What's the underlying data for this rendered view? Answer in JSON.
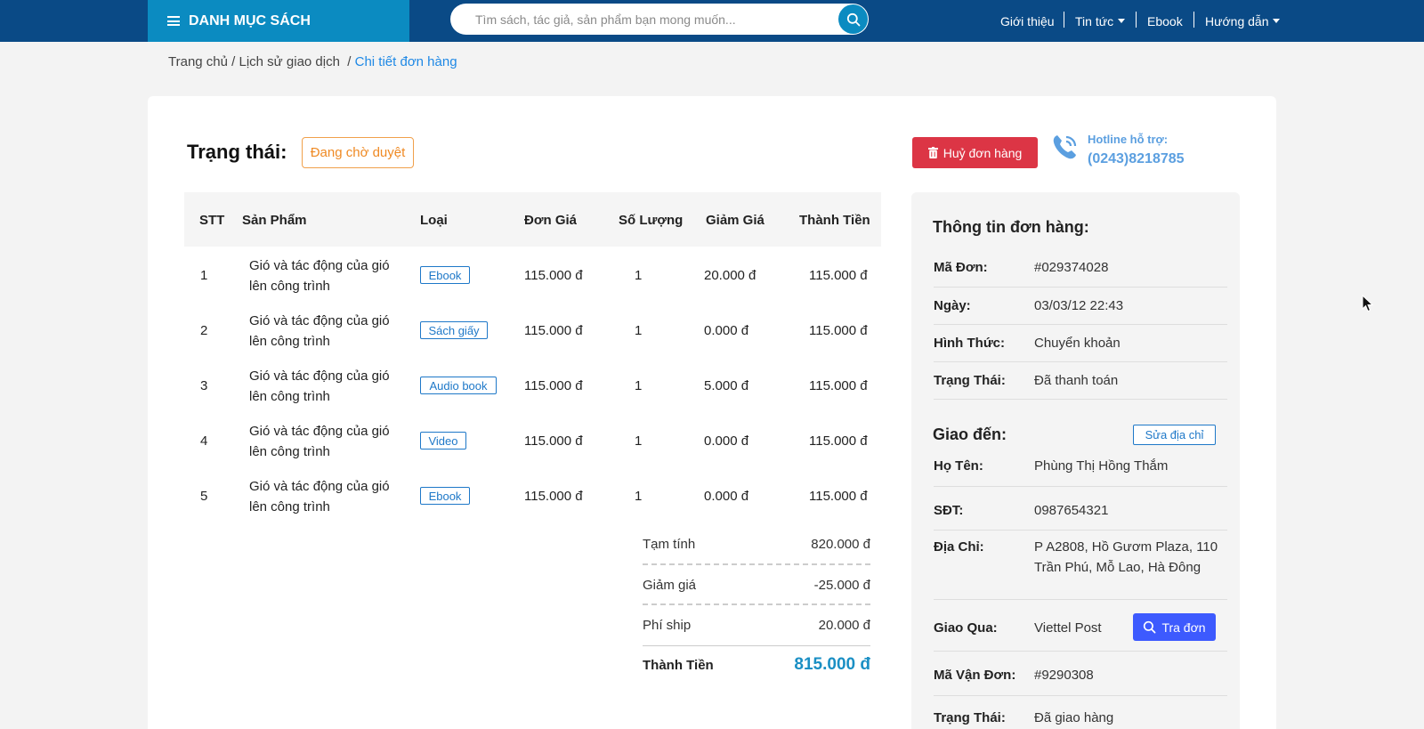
{
  "topbar": {
    "category_label": "DANH MỤC SÁCH",
    "search_placeholder": "Tìm sách, tác giả, sản phẩm bạn mong muốn...",
    "nav": {
      "about": "Giới thiệu",
      "news": "Tin tức",
      "ebook": "Ebook",
      "guide": "Hướng dẫn"
    },
    "colors": {
      "bar": "#0a4a86",
      "accent": "#0b8bc1"
    }
  },
  "breadcrumb": {
    "home": "Trang chủ",
    "sep1": "/",
    "history": "Lịch sử giao dịch",
    "sep2": "/",
    "current": "Chi tiết đơn hàng"
  },
  "order": {
    "status_label": "Trạng thái:",
    "status_value": "Đang chờ duyệt",
    "cancel_label": "Huỷ đơn hàng",
    "hotline_label": "Hotline hỗ trợ:",
    "hotline_number": "(0243)8218785"
  },
  "table": {
    "headers": {
      "stt": "STT",
      "product": "Sản Phẩm",
      "type": "Loại",
      "price": "Đơn Giá",
      "qty": "Số Lượng",
      "discount": "Giảm Giá",
      "total": "Thành Tiền"
    },
    "rows": [
      {
        "stt": "1",
        "product_l1": "Gió và tác động của gió",
        "product_l2": "lên công trình",
        "type": "Ebook",
        "price": "115.000 đ",
        "qty": "1",
        "discount": "20.000 đ",
        "total": "115.000 đ"
      },
      {
        "stt": "2",
        "product_l1": "Gió và tác động của gió",
        "product_l2": "lên công trình",
        "type": "Sách giấy",
        "price": "115.000 đ",
        "qty": "1",
        "discount": "0.000 đ",
        "total": "115.000 đ"
      },
      {
        "stt": "3",
        "product_l1": "Gió và tác động của gió",
        "product_l2": "lên công trình",
        "type": "Audio book",
        "price": "115.000 đ",
        "qty": "1",
        "discount": "5.000 đ",
        "total": "115.000 đ"
      },
      {
        "stt": "4",
        "product_l1": "Gió và tác động của gió",
        "product_l2": "lên công trình",
        "type": "Video",
        "price": "115.000 đ",
        "qty": "1",
        "discount": "0.000 đ",
        "total": "115.000 đ"
      },
      {
        "stt": "5",
        "product_l1": "Gió và tác động của gió",
        "product_l2": "lên công trình",
        "type": "Ebook",
        "price": "115.000 đ",
        "qty": "1",
        "discount": "0.000 đ",
        "total": "115.000 đ"
      }
    ]
  },
  "summary": {
    "subtotal_label": "Tạm tính",
    "subtotal_value": "820.000 đ",
    "discount_label": "Giảm giá",
    "discount_value": "-25.000 đ",
    "shipping_label": "Phí ship",
    "shipping_value": "20.000 đ",
    "total_label": "Thành Tiền",
    "total_value": "815.000 đ"
  },
  "info": {
    "title": "Thông tin đơn hàng:",
    "order_id_label": "Mã Đơn:",
    "order_id": "#029374028",
    "date_label": "Ngày:",
    "date": "03/03/12 22:43",
    "method_label": "Hình Thức:",
    "method": "Chuyển khoản",
    "pay_status_label": "Trạng Thái:",
    "pay_status": "Đã thanh toán"
  },
  "shipping": {
    "title": "Giao đến:",
    "edit_label": "Sửa địa chỉ",
    "name_label": "Họ Tên:",
    "name": "Phùng Thị Hồng Thắm",
    "phone_label": "SĐT:",
    "phone": "0987654321",
    "address_label": "Địa Chỉ:",
    "address_l1": "P A2808, Hồ Gươm Plaza, 110",
    "address_l2": "Trần Phú, Mỗ Lao, Hà Đông",
    "carrier_label": "Giao Qua:",
    "carrier": "Viettel Post",
    "track_label": "Tra đơn",
    "waybill_label": "Mã Vận Đơn:",
    "waybill": "#9290308",
    "ship_status_label": "Trạng Thái:",
    "ship_status": "Đã giao hàng"
  }
}
